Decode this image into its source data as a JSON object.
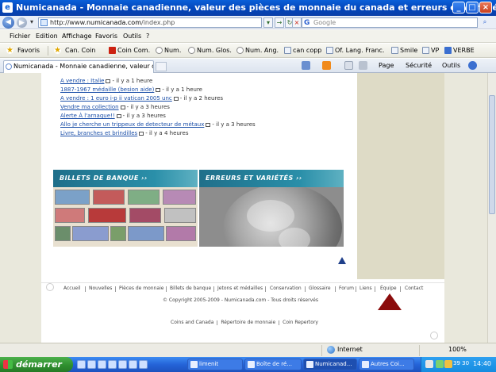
{
  "window": {
    "title": "Numicanada - Monnaie canadienne, valeur des pièces de monnaie du canada et erreurs et variétés ..."
  },
  "address": {
    "scheme": "http://www.",
    "domain": "numicanada.com",
    "path": "/index.php",
    "search_placeholder": "Google"
  },
  "menu": [
    "Fichier",
    "Edition",
    "Affichage",
    "Favoris",
    "Outils",
    "?"
  ],
  "favorites": {
    "label": "Favoris",
    "items": [
      "Can. Coin",
      "Coin Com.",
      "Num.",
      "Num. Glos.",
      "Num. Ang.",
      "can copp",
      "Of. Lang. Franc.",
      "Smile",
      "VP",
      "VERBE"
    ]
  },
  "tab": {
    "label": "Numicanada - Monnaie canadienne, valeur d..."
  },
  "commands": {
    "page": "Page",
    "security": "Sécurité",
    "tools": "Outils"
  },
  "recent_posts": [
    {
      "title": "A vendre : Italie",
      "age": "- il y a 1 heure"
    },
    {
      "title": "1887-1967 médaille (besion aide)",
      "age": "- il y a 1 heure"
    },
    {
      "title": "A vendre : 1 euro i-p ii vatican 2005 unc",
      "age": "- il y a 2 heures"
    },
    {
      "title": "Vendre ma collection",
      "age": "- il y a 3 heures"
    },
    {
      "title": "Alerte À l'arnaque!!",
      "age": "- il y a 3 heures"
    },
    {
      "title": "Allo je cherche un trippeux de detecteur de métaux",
      "age": "- il y a 3 heures"
    },
    {
      "title": "Livre, branches et brindilles",
      "age": "- il y a 4 heures"
    }
  ],
  "banners": {
    "notes": "BILLETS DE BANQUE ››",
    "errors": "ERREURS ET VARIÉTÉS ››"
  },
  "footer_nav": [
    "Accueil",
    "Nouvelles",
    "Pièces de monnaie",
    "Billets de banque",
    "Jetons et médailles",
    "Conservation",
    "Glossaire",
    "Forum",
    "Liens",
    "Équipe",
    "Contact"
  ],
  "copyright": "©  Copyright  2005-2009 -  Numicanada.com - Tous droits réservés",
  "sub_footer": [
    "Coins and Canada",
    "Répertoire de monnaie",
    "Coin Repertory"
  ],
  "status": {
    "zone": "Internet",
    "zoom": "100%"
  },
  "taskbar": {
    "start": "démarrer",
    "tasks": [
      "limenit",
      "Boîte de ré...",
      "Numicanad...",
      "Autres Coi..."
    ],
    "tray_numbers": "39  30",
    "clock": "14:40"
  },
  "colors": {
    "link": "#1a4ea8",
    "annotation_arrow": "#8b0c0c",
    "sidebar": "#dedbc6"
  }
}
